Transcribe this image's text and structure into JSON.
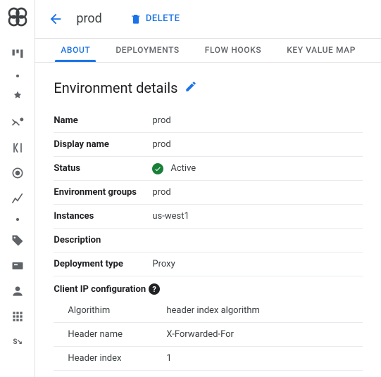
{
  "header": {
    "title": "prod",
    "delete_label": "DELETE"
  },
  "tabs": {
    "about": "ABOUT",
    "deployments": "DEPLOYMENTS",
    "flowhooks": "FLOW HOOKS",
    "kvm": "KEY VALUE MAP"
  },
  "section": {
    "title": "Environment details"
  },
  "details": {
    "name_label": "Name",
    "name_value": "prod",
    "display_name_label": "Display name",
    "display_name_value": "prod",
    "status_label": "Status",
    "status_value": "Active",
    "env_groups_label": "Environment groups",
    "env_groups_value": "prod",
    "instances_label": "Instances",
    "instances_value": "us-west1",
    "description_label": "Description",
    "description_value": "",
    "deployment_type_label": "Deployment type",
    "deployment_type_value": "Proxy"
  },
  "client_ip": {
    "header": "Client IP configuration",
    "algorithm_label": "Algorithim",
    "algorithm_value": "header index algorithm",
    "header_name_label": "Header name",
    "header_name_value": "X-Forwarded-For",
    "header_index_label": "Header index",
    "header_index_value": "1"
  }
}
